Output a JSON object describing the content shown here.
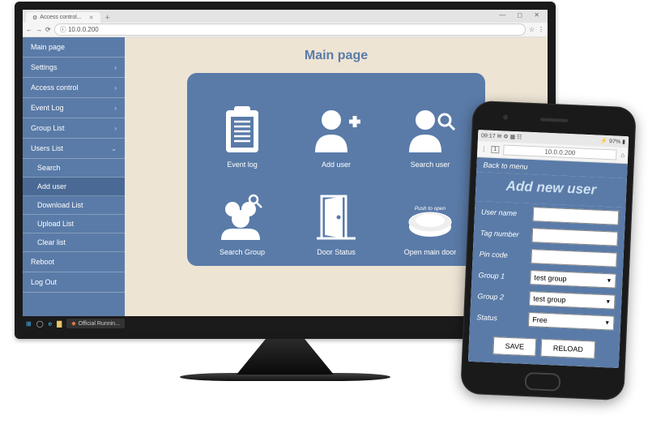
{
  "browser": {
    "tab_title": "Access control...",
    "url": "10.0.0.200",
    "window_buttons": "—  ◻  ✕"
  },
  "sidebar": {
    "items": [
      {
        "label": "Main page",
        "expandable": false
      },
      {
        "label": "Settings",
        "expandable": true
      },
      {
        "label": "Access control",
        "expandable": true
      },
      {
        "label": "Event Log",
        "expandable": true
      },
      {
        "label": "Group List",
        "expandable": true
      },
      {
        "label": "Users List",
        "expandable": true,
        "open": true
      }
    ],
    "subitems": [
      {
        "label": "Search"
      },
      {
        "label": "Add user",
        "active": true
      },
      {
        "label": "Download List"
      },
      {
        "label": "Upload List"
      },
      {
        "label": "Clear list"
      }
    ],
    "items_after": [
      {
        "label": "Reboot"
      },
      {
        "label": "Log Out"
      }
    ]
  },
  "main": {
    "title": "Main page",
    "tiles": [
      {
        "label": "Event log"
      },
      {
        "label": "Add user"
      },
      {
        "label": "Search user"
      },
      {
        "label": "Search Group"
      },
      {
        "label": "Door Status"
      },
      {
        "label": "Open main door"
      }
    ],
    "push_text": "Push to open"
  },
  "taskbar": {
    "item_label": "Official Runnin..."
  },
  "phone": {
    "status_left": "09:17 ✉ ⚙ ▦ ☷",
    "status_right": "⚡ 97% ▮",
    "url": "10.0.0.200",
    "back_label": "Back to menu",
    "page_title": "Add new user",
    "fields": {
      "user_name_label": "User name",
      "tag_number_label": "Tag number",
      "pin_code_label": "Pin code",
      "group1_label": "Group 1",
      "group1_value": "test group",
      "group2_label": "Group 2",
      "group2_value": "test group",
      "status_label": "Status",
      "status_value": "Free"
    },
    "buttons": {
      "save": "SAVE",
      "reload": "RELOAD"
    }
  }
}
